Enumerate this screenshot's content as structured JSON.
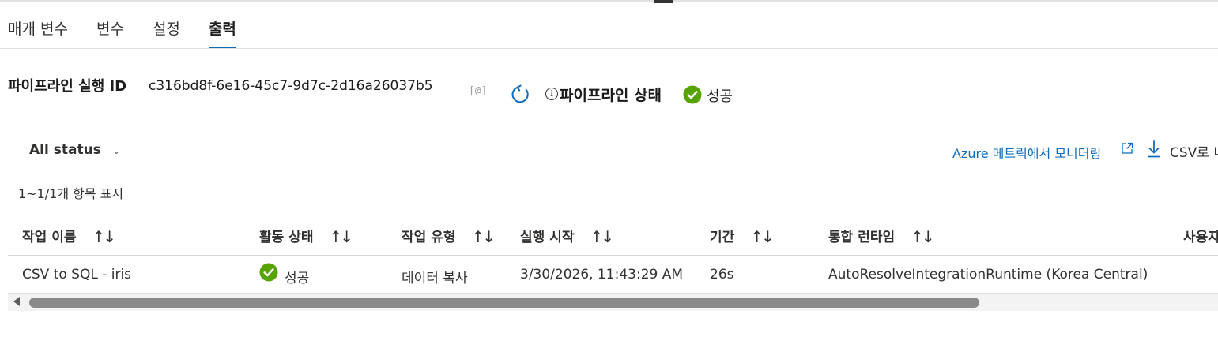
{
  "tabs": [
    {
      "label": "매개 변수"
    },
    {
      "label": "변수"
    },
    {
      "label": "설정"
    },
    {
      "label": "출력"
    }
  ],
  "run": {
    "label": "파이프라인 실행 ID",
    "id": "c316bd8f-6e16-45c7-9d7c-2d16a26037b5",
    "copy_icon": "[@]",
    "status_label": "파이프라인 상태",
    "status_value": "성공"
  },
  "toolbar": {
    "filter_label": "All status",
    "azure_link": "Azure 메트릭에서 모니터링",
    "csv_label": "CSV로 내"
  },
  "item_count": "1~1/1개 항목 표시",
  "table": {
    "columns": [
      "작업 이름",
      "활동 상태",
      "작업 유형",
      "실행 시작",
      "기간",
      "통합 런타임",
      "사용자"
    ],
    "rows": [
      {
        "name": "CSV to SQL - iris",
        "status": "성공",
        "type": "데이터 복사",
        "start": "3/30/2026, 11:43:29 AM",
        "duration": "26s",
        "runtime": "AutoResolveIntegrationRuntime (Korea Central)"
      }
    ]
  },
  "colors": {
    "accent": "#0f6cbd",
    "success": "#57a300"
  },
  "icons": {
    "refresh": "refresh-icon",
    "info": "info-icon",
    "success": "check-circle-icon",
    "external": "external-link-icon",
    "download": "download-icon",
    "sort": "sort-icon"
  }
}
